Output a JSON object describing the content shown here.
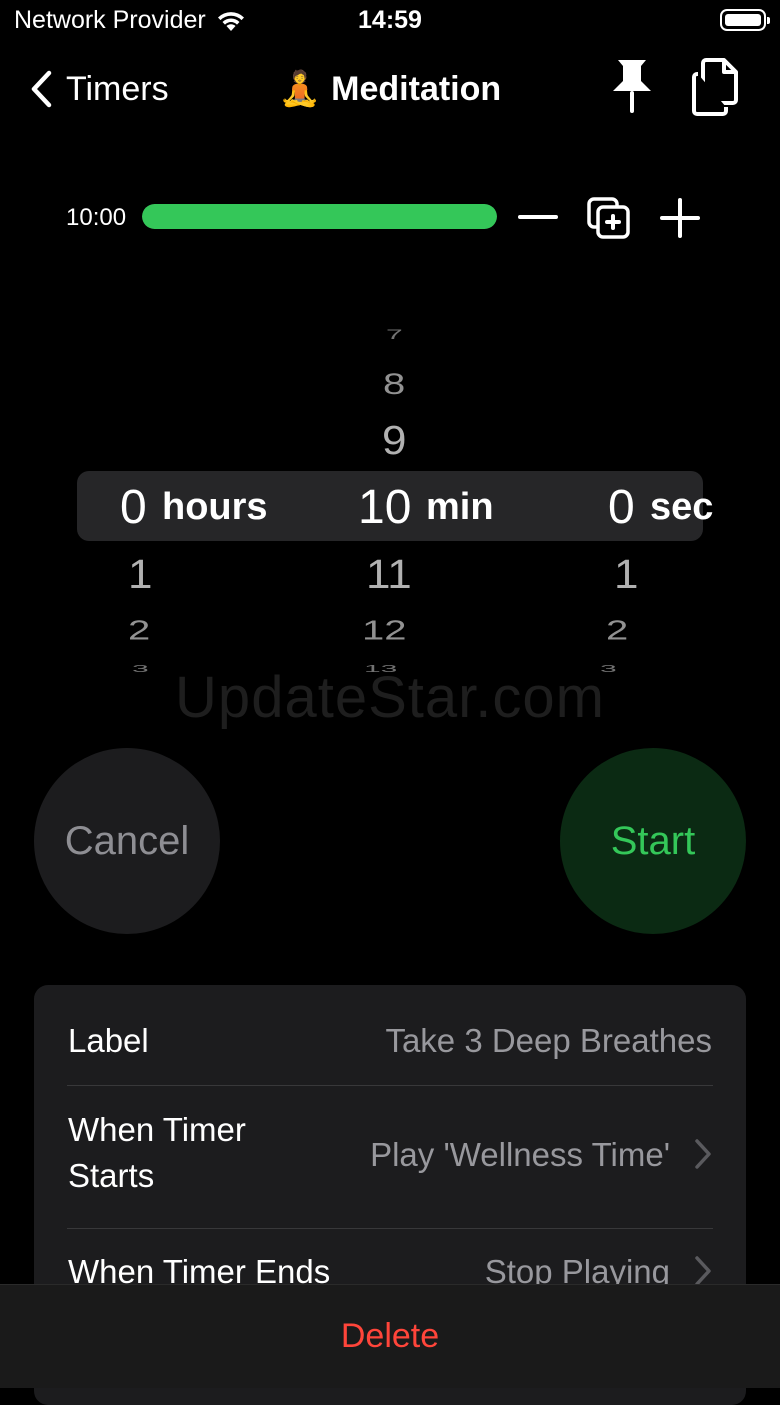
{
  "status_bar": {
    "carrier": "Network Provider",
    "time": "14:59"
  },
  "nav": {
    "back_label": "Timers",
    "title_emoji": "🧘",
    "title": "Meditation"
  },
  "progress": {
    "time_label": "10:00",
    "fraction": 1.0,
    "color": "#34c759"
  },
  "picker": {
    "hours": {
      "above": [
        "",
        ""
      ],
      "selected": "0",
      "unit": "hours",
      "below": [
        "1",
        "2",
        "3"
      ]
    },
    "minutes": {
      "above": [
        "7",
        "8",
        "9"
      ],
      "selected": "10",
      "unit": "min",
      "below": [
        "11",
        "12",
        "13"
      ]
    },
    "seconds": {
      "above": [
        "",
        ""
      ],
      "selected": "0",
      "unit": "sec",
      "below": [
        "1",
        "2",
        "3"
      ]
    }
  },
  "watermark": "UpdateStar.com",
  "buttons": {
    "cancel": "Cancel",
    "start": "Start"
  },
  "settings": {
    "label_title": "Label",
    "label_value": "Take 3 Deep Breathes",
    "start_title_line1": "When Timer",
    "start_title_line2": "Starts",
    "start_value": "Play 'Wellness Time'",
    "end_title": "When Timer Ends",
    "end_value": "Stop Playing"
  },
  "bottom": {
    "delete": "Delete"
  },
  "colors": {
    "accent_green": "#34c759",
    "destructive": "#ff453a",
    "background": "#000000"
  }
}
